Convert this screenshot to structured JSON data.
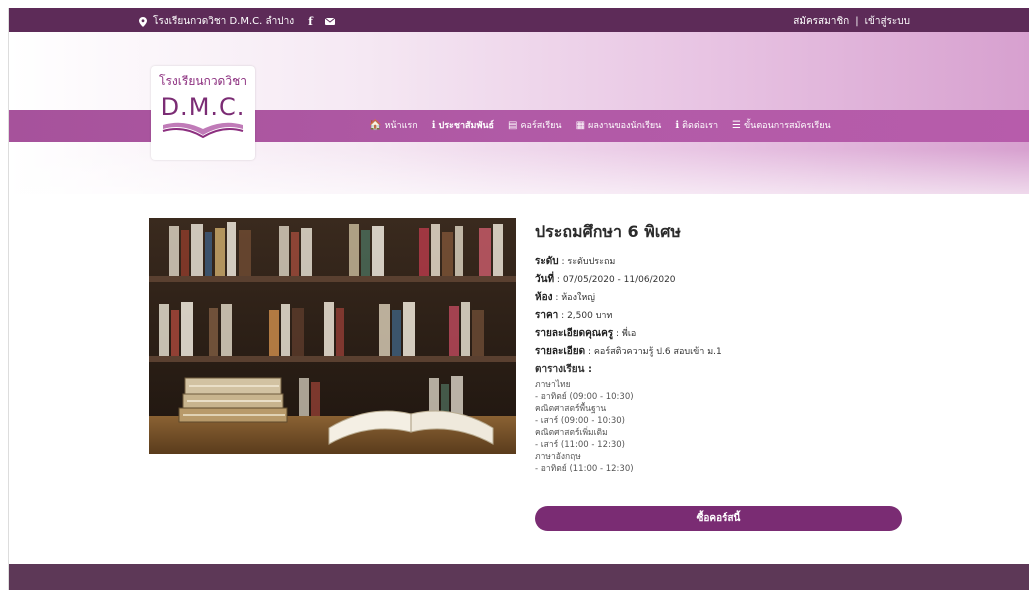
{
  "topbar": {
    "school_location": "โรงเรียนกวดวิชา D.M.C. ลำปาง",
    "facebook_glyph": "f",
    "register": "สมัครสมาชิก",
    "separator": "|",
    "login": "เข้าสู่ระบบ"
  },
  "logo": {
    "line1": "โรงเรียนกวดวิชา",
    "line2": "D.M.C."
  },
  "nav": {
    "items": [
      {
        "icon": "home-icon",
        "glyph": "🏠",
        "label": "หน้าแรก"
      },
      {
        "icon": "info-icon",
        "glyph": "ℹ",
        "label": "ประชาสัมพันธ์"
      },
      {
        "icon": "book-icon",
        "glyph": "▤",
        "label": "คอร์สเรียน"
      },
      {
        "icon": "newspaper-icon",
        "glyph": "▦",
        "label": "ผลงานของนักเรียน"
      },
      {
        "icon": "info-icon",
        "glyph": "ℹ",
        "label": "ติดต่อเรา"
      },
      {
        "icon": "list-icon",
        "glyph": "☰",
        "label": "ขั้นตอนการสมัครเรียน"
      }
    ],
    "active_index": 1
  },
  "course": {
    "title": "ประถมศึกษา 6 พิเศษ",
    "level_label": "ระดับ",
    "level": "ระดับประถม",
    "date_label": "วันที่",
    "date": "07/05/2020 - 11/06/2020",
    "room_label": "ห้อง",
    "room": "ห้องใหญ่",
    "price_label": "ราคา",
    "price": "2,500 บาท",
    "teacher_label": "รายละเอียดคุณครู",
    "teacher": "พี่เอ",
    "detail_label": "รายละเอียด",
    "detail": "คอร์สติวความรู้ ป.6 สอบเข้า ม.1",
    "schedule_label": "ตารางเรียน :",
    "schedule": [
      "ภาษาไทย",
      "- อาทิตย์ (09:00 - 10:30)",
      "คณิตศาสตร์พื้นฐาน",
      "- เสาร์ (09:00 - 10:30)",
      "คณิตศาสตร์เพิ่มเติม",
      "- เสาร์ (11:00 - 12:30)",
      "ภาษาอังกฤษ",
      "- อาทิตย์ (11:00 - 12:30)"
    ],
    "buy_button": "ซื้อคอร์สนี้"
  },
  "colors": {
    "topbar": "#5d2b58",
    "navband": "#b15aa6",
    "button": "#7a2c73",
    "footer": "#5d3857"
  }
}
